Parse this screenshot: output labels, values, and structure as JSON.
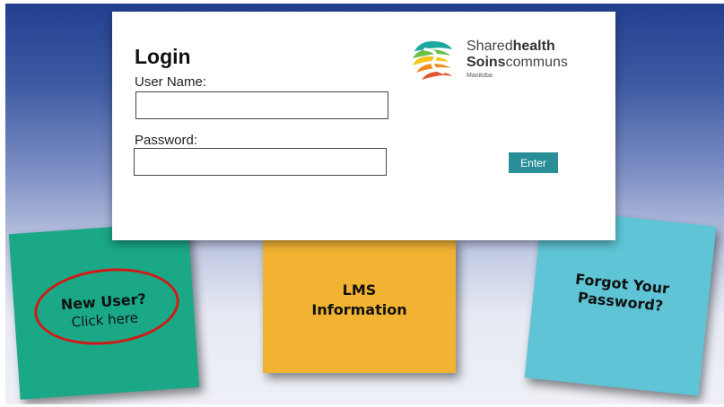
{
  "login": {
    "title": "Login",
    "username_label": "User Name:",
    "username_value": "",
    "password_label": "Password:",
    "password_value": "",
    "enter_label": "Enter"
  },
  "logo": {
    "line1_light": "Shared",
    "line1_bold": "health",
    "line2_bold": "Soins",
    "line2_light": "communs",
    "line3": "Manitoba"
  },
  "tiles": {
    "new_user_title": "New User?",
    "new_user_sub": "Click here",
    "lms_line1": "LMS",
    "lms_line2": "Information",
    "forgot_line1": "Forgot Your",
    "forgot_line2": "Password?"
  },
  "colors": {
    "new_user_tile": "#1aa887",
    "lms_tile": "#f2b333",
    "forgot_tile": "#5ec4d6",
    "enter_button": "#2a8e98",
    "highlight_circle": "#d11a16"
  }
}
